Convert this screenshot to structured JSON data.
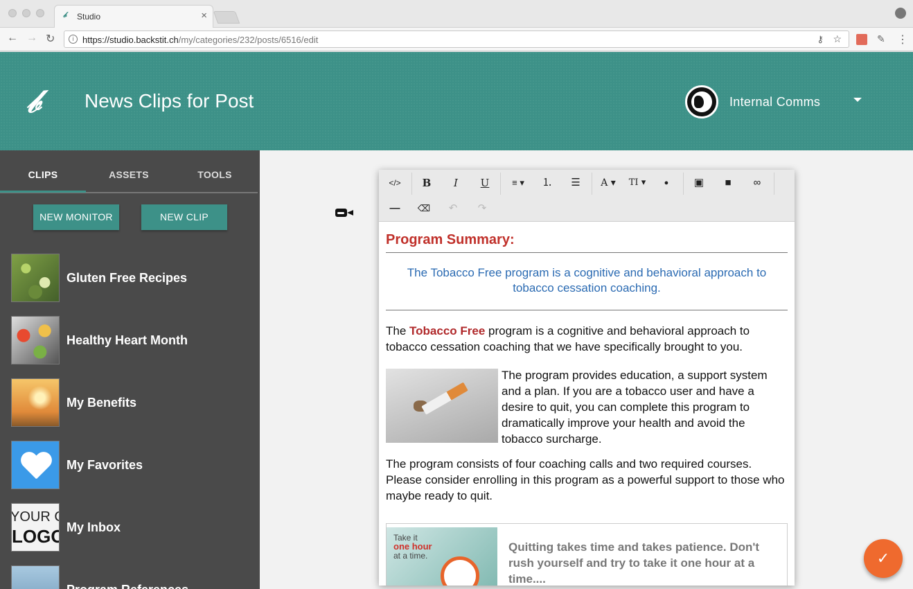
{
  "browser": {
    "tab_title": "Studio",
    "tab_close": "×",
    "url_host": "https://studio.backstit.ch",
    "url_path": "/my/categories/232/posts/6516/edit"
  },
  "header": {
    "logo_glyph": "𝒷",
    "title": "News Clips for Post",
    "org_name": "Internal Comms"
  },
  "sidebar": {
    "tabs": [
      {
        "label": "CLIPS",
        "active": true
      },
      {
        "label": "ASSETS",
        "active": false
      },
      {
        "label": "TOOLS",
        "active": false
      }
    ],
    "new_monitor_label": "NEW MONITOR",
    "new_clip_label": "NEW CLIP",
    "items": [
      {
        "label": "Gluten Free Recipes"
      },
      {
        "label": "Healthy Heart Month"
      },
      {
        "label": "My Benefits"
      },
      {
        "label": "My Favorites"
      },
      {
        "label": "My Inbox",
        "thumb_line1": "YOUR CO",
        "thumb_line2": "LOGO"
      },
      {
        "label": "Program References"
      }
    ]
  },
  "toolbar": {
    "code": "</>",
    "bold": "B",
    "italic": "I",
    "underline": "U",
    "align": "≡ ▾",
    "ordered_list": "⒈",
    "unordered_list": "☰",
    "font": "A ▾",
    "font_size": "TI ▾",
    "color": "●",
    "image": "▣",
    "video": "■",
    "link": "∞",
    "hr": "—",
    "eraser": "⌫",
    "undo": "↶",
    "redo": "↷"
  },
  "document": {
    "heading": "Program Summary:",
    "blue_quote": "The Tobacco Free program is a cognitive and behavioral approach to tobacco cessation coaching.",
    "para1_before": "The ",
    "para1_highlight": "Tobacco Free",
    "para1_after": " program is a cognitive and behavioral approach to tobacco cessation coaching that we have specifically brought to you.",
    "para2": "The program provides education, a support system and a plan. If you are a tobacco user and have a desire to quit, you can complete this program to dramatically improve your health and avoid the tobacco surcharge.",
    "para3": "The program consists of four coaching calls and two required courses. Please consider enrolling in this program as a powerful support to those who maybe ready to quit.",
    "card_image_line1": "Take it",
    "card_image_line2": "one hour",
    "card_image_line3": "at a time.",
    "card_text": "Quitting takes time and takes patience. Don't rush yourself and try to take it one hour at a time...."
  },
  "fab": {
    "icon": "✓"
  },
  "colors": {
    "brand_teal": "#3d9188",
    "sidebar_bg": "#4a4a4a",
    "heading_red": "#c0302a",
    "quote_blue": "#2a6ab2",
    "fab_orange": "#ef6a2e"
  }
}
